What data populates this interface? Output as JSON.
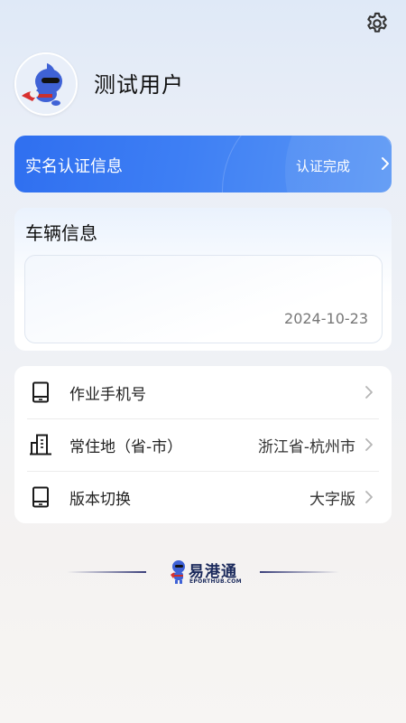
{
  "profile": {
    "username": "测试用户"
  },
  "auth": {
    "title": "实名认证信息",
    "status": "认证完成"
  },
  "vehicle": {
    "title": "车辆信息",
    "date": "2024-10-23"
  },
  "menu": {
    "items": [
      {
        "label": "作业手机号",
        "value": "",
        "icon": "phone-icon"
      },
      {
        "label": "常住地（省-市）",
        "value": "浙江省-杭州市",
        "icon": "building-icon"
      },
      {
        "label": "版本切换",
        "value": "大字版",
        "icon": "tablet-icon"
      }
    ]
  },
  "footer": {
    "brand": "易港通",
    "brand_sub": "EPORTHUB.COM"
  },
  "colors": {
    "accent": "#3a7af2",
    "brand": "#1b2a5c"
  }
}
